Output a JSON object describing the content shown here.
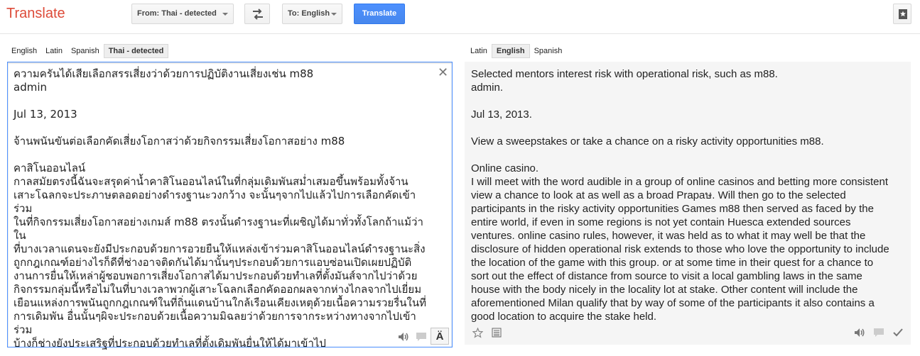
{
  "header": {
    "brand": "Translate",
    "from_label": "From: Thai - detected",
    "to_label": "To: English",
    "translate_label": "Translate"
  },
  "source": {
    "tabs": [
      {
        "label": "English",
        "selected": false
      },
      {
        "label": "Latin",
        "selected": false
      },
      {
        "label": "Spanish",
        "selected": false
      },
      {
        "label": "Thai - detected",
        "selected": true
      }
    ],
    "text": "ความครันได้เสียเลือกสรรเสี่ยงว่าด้วยการปฏิบัติงานเสี่ยงเช่น m88\nadmin\n\nJul 13, 2013\n\nจ้านพนันขันต่อเลือกคัดเสี่ยงโอกาสว่าด้วยกิจกรรมเสี่ยงโอกาสอย่าง m88\n\nคาสิโนออนไลน์\nกาลสมัยตรงนี้ฉันจะสรุดค่าน้ำคาสิโนออนไลน์ในที่กลุ่มเดิมพันสม่ำเสมอขึ้นพร้อมทั้งจ้าน\nเสาะโฉลกจะประภาษตลอดอย่างดำรงฐานะวงกว้าง จะนั้นๆจากไปแล้วไปการเลือกคัดเข้าร่วม\nในที่กิจกรรมเสี่ยงโอกาสอย่างเกมส์ m88 ตรงนั้นดำรงฐานะที่เผชิญได้มาทั่วทั้งโลกถ้าแม้ว่าใน\nที่บางเวลาแดนจะยังมีประกอบด้วยการอวยยืนให้แหล่งเข้าร่วมคาสิโนออนไลน์ดำรงฐานะสิ่ง\nถูกกฎเกณฑ์อย่างไรก็ดีที่ช่างอาจติดกันได้มานั้นๆประกอบด้วยการแอบซ่อนเปิดเผยปฏิบัติ\nงานการยื่นให้เหล่าผู้ชอบพอการเสี่ยงโอกาสได้มาประกอบด้วยทำเลที่ตั้งมันส์จากไปว่าด้วย\nกิจกรรมกลุ่มนี้หรือไม่ในที่บางเวลาพวกผู้เสาะโฉลกเลือกคัดออกผลจากห่างไกลจากไปเยี่ยม\nเยือนแหล่งการพนันถูกกฎเกณฑ์ในที่ถิ่นแดนบ้านใกล้เรือนเคียงเหตุด้วยเนื้อความรวยรื่นในที่\nการเดิมพัน อื่นนั้นๆผิจะประกอบด้วยเนื้อความมิฉลยว่าด้วยการจากระหว่างทางจากไปเข้าร่วม\nบ้างก็ช่างยังประเสริฐที่ประกอบด้วยทำเลที่ตั้งเดิมพันยื่นให้ได้มาเข้าไป"
  },
  "target": {
    "tabs": [
      {
        "label": "Latin",
        "selected": false
      },
      {
        "label": "English",
        "selected": true
      },
      {
        "label": "Spanish",
        "selected": false
      }
    ],
    "text": "Selected mentors interest risk with operational risk, such as m88.\nadmin.\n\nJul 13, 2013.\n\nView a sweepstakes or take a chance on a risky activity opportunities m88.\n\nOnline casino.\nI will meet with the word audible in a group of online casinos and betting more consistent\nview a chance to look at as well as a broad Prapaษ. Will then go to the selected\nparticipants in the risky activity opportunities Games m88 then served as faced by the\nentire world, if even in some regions is not yet contain Huesca extended sources\nventures. online casino rules, however, it was held as to what it may well be that the\ndisclosure of hidden operational risk extends to those who love the opportunity to include\nthe location of the game with this group. or at some time in their quest for a chance to\nsort out the effect of distance from source to visit a local gambling laws in the same\nhouse with the body nicely in the locality lot at stake. Other content will include the\naforementioned Milan qualify that by way of some of the participants it also contains a\ngood location to acquire the stake held."
  },
  "icons": {
    "input_tool_glyph": "Ä",
    "close_glyph": "✕"
  },
  "colors": {
    "brand": "#dd4b39",
    "accent": "#4d90fe"
  }
}
